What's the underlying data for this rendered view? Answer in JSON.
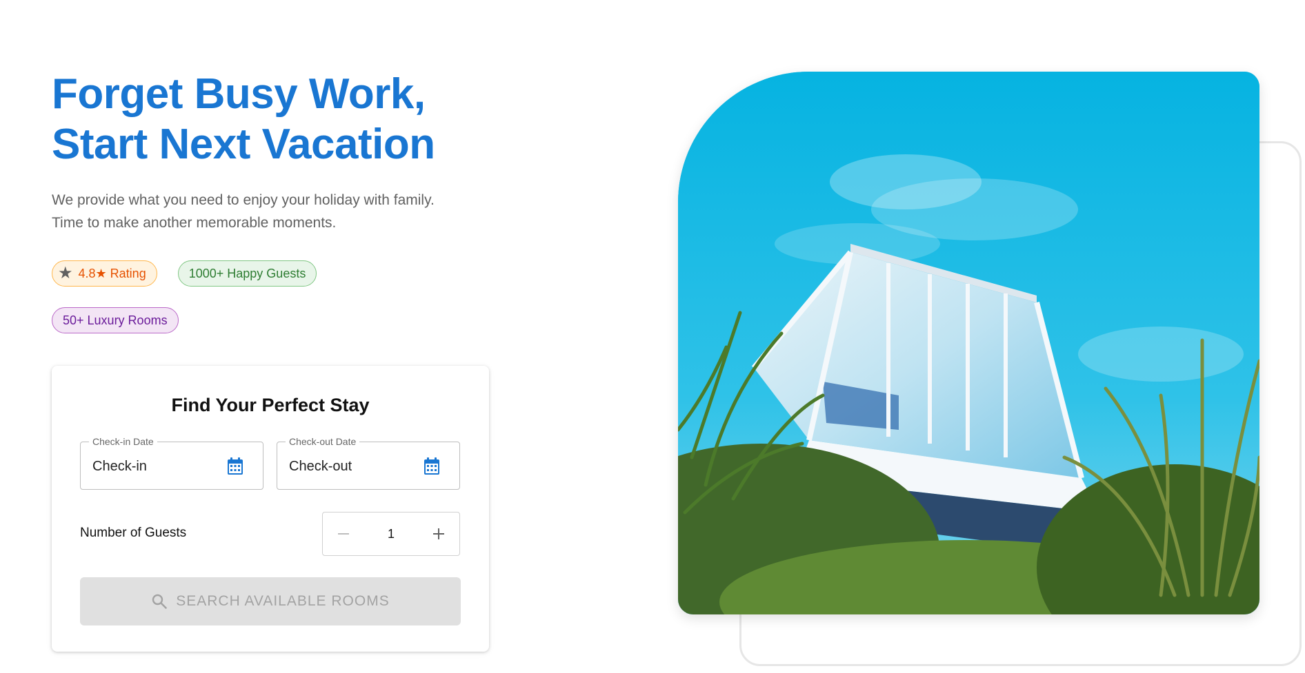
{
  "hero": {
    "headline_line1": "Forget Busy Work,",
    "headline_line2": "Start Next Vacation",
    "subtitle_line1": "We provide what you need to enjoy your holiday with family.",
    "subtitle_line2": "Time to make another memorable moments."
  },
  "badges": {
    "rating": {
      "icon": "star-icon",
      "label": "4.8★ Rating",
      "color": "#e65100"
    },
    "guests": {
      "label": "1000+ Happy Guests",
      "color": "#2e7d32"
    },
    "rooms": {
      "label": "50+ Luxury Rooms",
      "color": "#6a1b9a"
    }
  },
  "search": {
    "title": "Find Your Perfect Stay",
    "checkin": {
      "label": "Check-in Date",
      "value": "Check-in",
      "icon": "calendar-icon"
    },
    "checkout": {
      "label": "Check-out Date",
      "value": "Check-out",
      "icon": "calendar-icon"
    },
    "guests": {
      "label": "Number of Guests",
      "value": "1",
      "decrement_icon": "minus-icon",
      "increment_icon": "plus-icon"
    },
    "button": {
      "label": "SEARCH AVAILABLE ROOMS",
      "icon": "search-icon",
      "state": "disabled"
    }
  },
  "colors": {
    "accent": "#1976d2",
    "sky": "#0fb4dd"
  }
}
